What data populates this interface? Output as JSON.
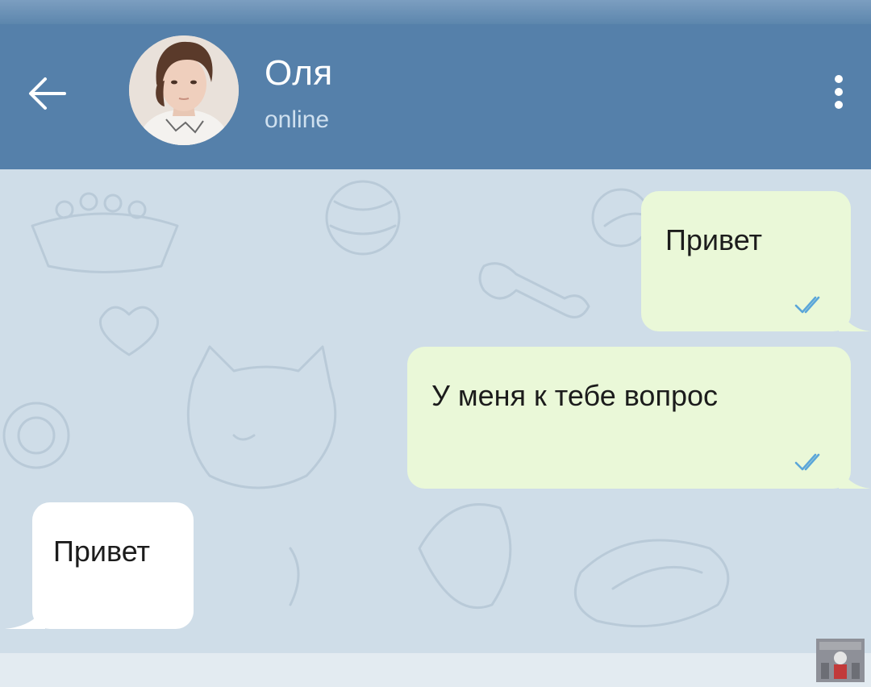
{
  "header": {
    "contact_name": "Оля",
    "contact_status": "online",
    "back_icon": "arrow-left-icon",
    "menu_icon": "more-vertical-icon"
  },
  "messages": [
    {
      "direction": "out",
      "text": "Привет",
      "status": "read"
    },
    {
      "direction": "out",
      "text": "У меня к тебе вопрос",
      "status": "read"
    },
    {
      "direction": "in",
      "text": "Привет"
    }
  ],
  "colors": {
    "header": "#5580aa",
    "chat_background": "#cfdde8",
    "outgoing_bubble": "#eaf8d8",
    "incoming_bubble": "#ffffff",
    "read_checks": "#5aa6d9"
  }
}
